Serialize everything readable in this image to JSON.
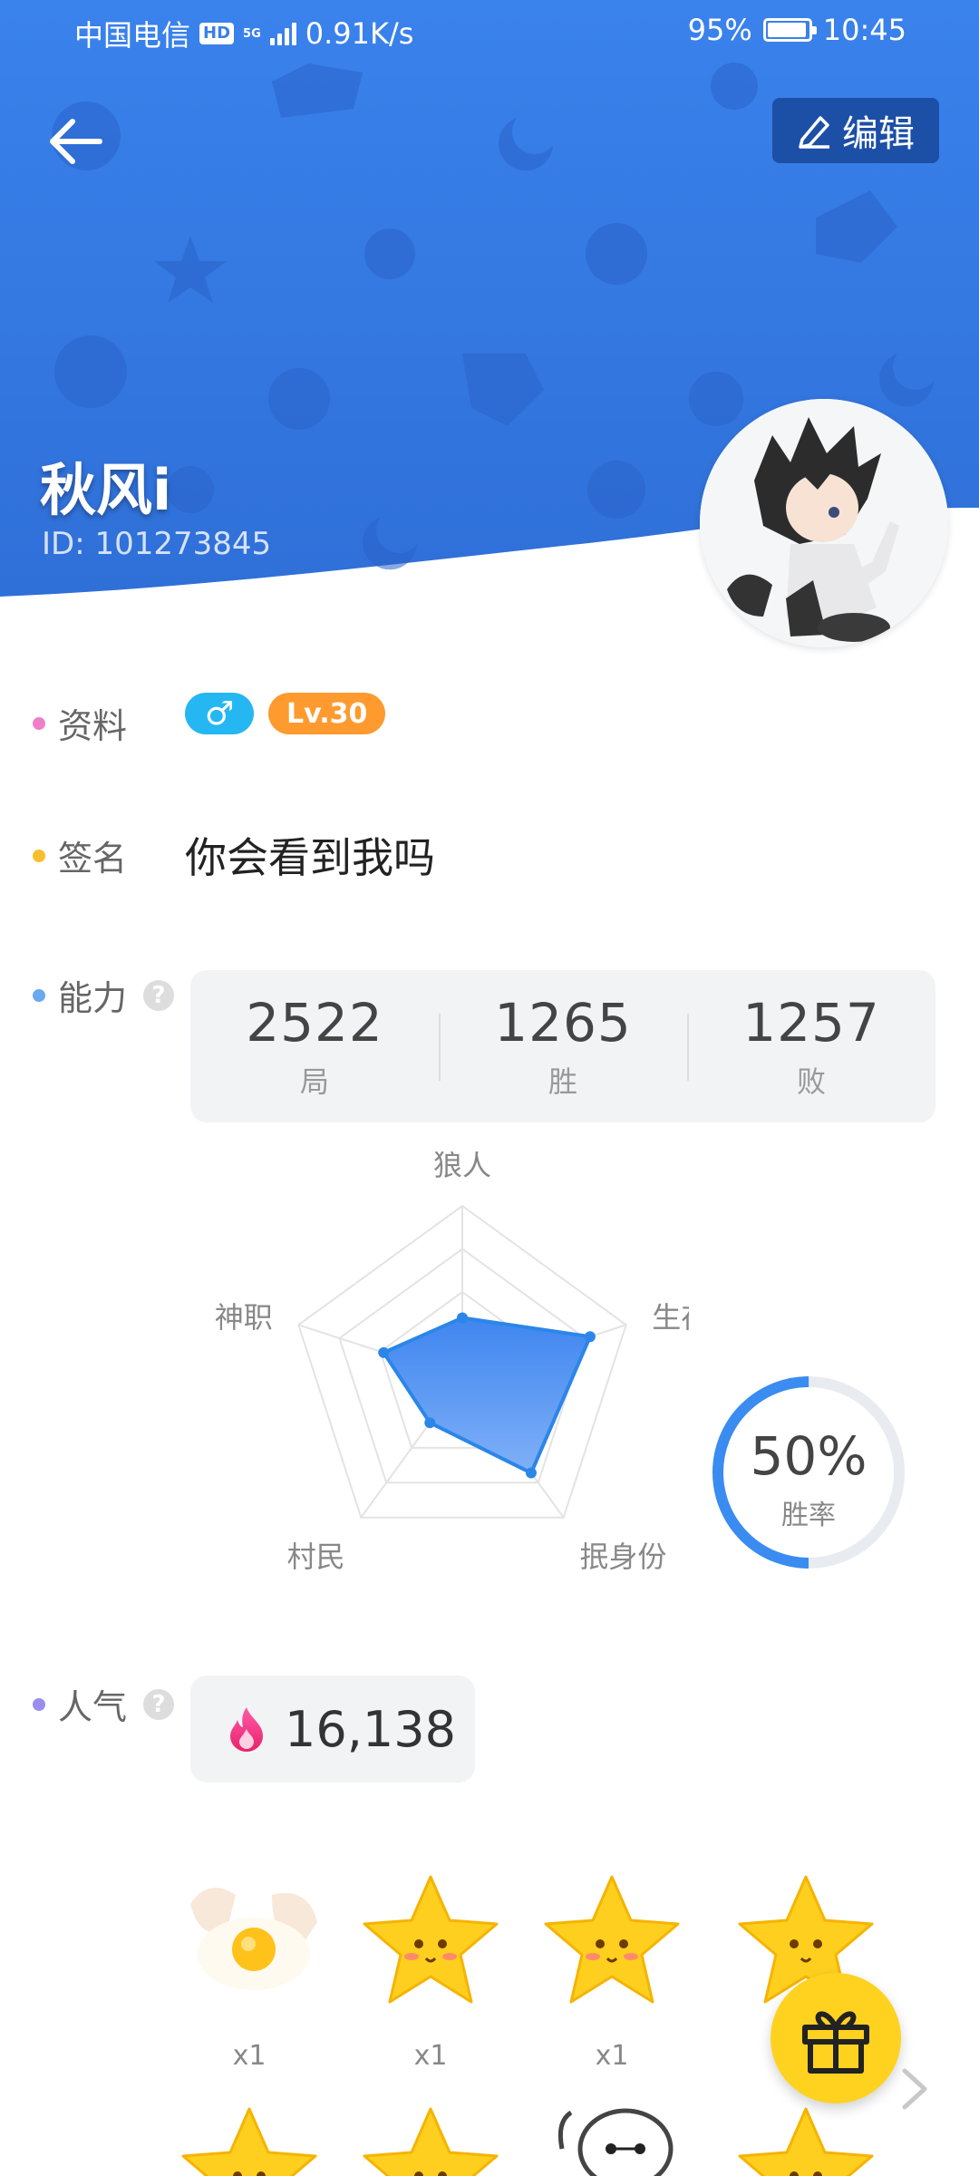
{
  "status_bar": {
    "carrier": "中国电信",
    "hd": "HD",
    "network": "5G",
    "speed": "0.91K/s",
    "battery": "95%",
    "battery_level": 0.95,
    "time": "10:45"
  },
  "header": {
    "edit_label": "编辑",
    "name": "秋风i",
    "id_text": "ID: 101273845"
  },
  "profile": {
    "label": "资料",
    "gender": "♂",
    "level": "Lv.30"
  },
  "signature": {
    "label": "签名",
    "text": "你会看到我吗"
  },
  "ability": {
    "label": "能力",
    "help": "?",
    "stats": [
      {
        "value": "2522",
        "caption": "局"
      },
      {
        "value": "1265",
        "caption": "胜"
      },
      {
        "value": "1257",
        "caption": "败"
      }
    ],
    "radar_axes": [
      "狼人",
      "生存",
      "抿身份",
      "村民",
      "神职"
    ],
    "radar_values": [
      0.35,
      0.78,
      0.68,
      0.32,
      0.48
    ],
    "win_rate": "50%",
    "win_rate_value": 0.5,
    "win_rate_label": "胜率"
  },
  "popularity": {
    "label": "人气",
    "help": "?",
    "value": "16,138"
  },
  "gifts": [
    {
      "icon": "egg-icon",
      "count": "x1"
    },
    {
      "icon": "star-icon",
      "count": "x1"
    },
    {
      "icon": "star-icon",
      "count": "x1"
    },
    {
      "icon": "star-icon",
      "count": ""
    },
    {
      "icon": "star-icon",
      "count": ""
    },
    {
      "icon": "star-icon",
      "count": ""
    },
    {
      "icon": "baymax-icon",
      "count": ""
    },
    {
      "icon": "star-icon",
      "count": ""
    }
  ],
  "colors": {
    "header_blue": "#3a7fe6",
    "accent": "#3a8cf0",
    "gender_blue": "#25b7f2",
    "level_orange": "#ff9a2e",
    "gift_yellow": "#ffd21f"
  }
}
